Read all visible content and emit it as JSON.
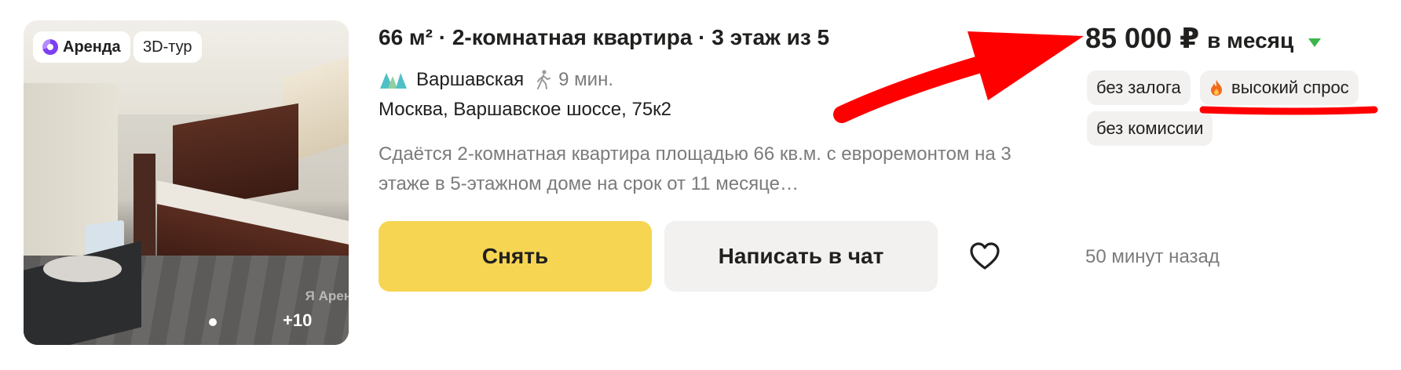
{
  "photo": {
    "badge_rent": "Аренда",
    "badge_3d": "3D-тур",
    "watermark": "Я Арен",
    "more_count": "+10"
  },
  "listing": {
    "title": "66 м² · 2-комнатная квартира · 3 этаж из 5",
    "metro_station": "Варшавская",
    "walk_time": "9 мин.",
    "address": "Москва, Варшавское шоссе, 75к2",
    "description": "Сдаётся 2-комнатная квартира площадью 66 кв.м. с евроремонтом на 3 этаже в 5-этажном доме на срок от 11 месяце…"
  },
  "actions": {
    "rent_label": "Снять",
    "chat_label": "Написать в чат",
    "favorite_icon": "heart-icon",
    "time_ago": "50 минут назад"
  },
  "price": {
    "value": "85 000 ₽",
    "period": "в месяц",
    "trend": "down",
    "trend_color": "#3bb54a"
  },
  "tags": {
    "no_deposit": "без залога",
    "high_demand": "высокий спрос",
    "no_commission": "без комиссии"
  },
  "colors": {
    "primary_button": "#f6d552",
    "secondary_button": "#f2f1f0",
    "annotation": "#ff0000",
    "muted_text": "#7b7b7b"
  }
}
